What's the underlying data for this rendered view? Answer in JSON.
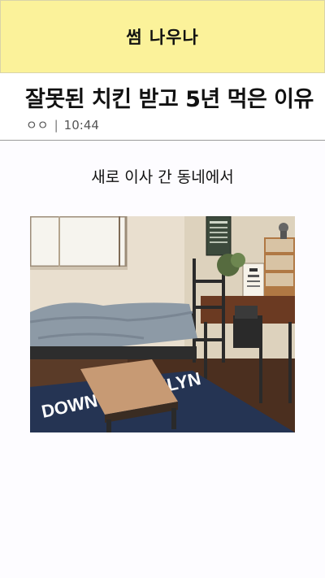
{
  "banner": {
    "logo_text": "썸 나우나"
  },
  "post": {
    "title": "잘못된 치킨 받고 5년 먹은 이유",
    "author": "ㅇㅇ",
    "separator": "|",
    "time": "10:44"
  },
  "content": {
    "caption": "새로 이사 간 동네에서",
    "photo": {
      "rug_text": "DOWN BROOKLYN"
    }
  },
  "colors": {
    "banner_bg": "#fbf29a",
    "page_bg": "#fdfcff"
  }
}
